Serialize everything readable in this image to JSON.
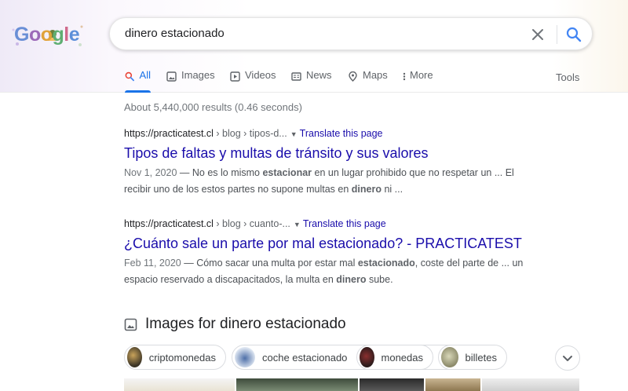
{
  "logo": {
    "text": "Google"
  },
  "search": {
    "query": "dinero estacionado"
  },
  "tabs": [
    {
      "label": "All",
      "icon": "search-icon",
      "active": true
    },
    {
      "label": "Images",
      "icon": "image-icon"
    },
    {
      "label": "Videos",
      "icon": "video-icon"
    },
    {
      "label": "News",
      "icon": "news-icon"
    },
    {
      "label": "Maps",
      "icon": "map-pin-icon"
    },
    {
      "label": "More",
      "icon": "more-vert-icon"
    }
  ],
  "tools_label": "Tools",
  "stats": "About 5,440,000 results (0.46 seconds)",
  "results": [
    {
      "domain": "https://practicatest.cl",
      "path": " › blog › tipos-d...",
      "translate": "Translate this page",
      "title": "Tipos de faltas y multas de tránsito y sus valores",
      "date": "Nov 1, 2020",
      "snippet_a": " — No es lo mismo ",
      "bold_a": "estacionar",
      "snippet_b": " en un lugar prohibido que no respetar un ... El recibir uno de los estos partes no supone multas en ",
      "bold_b": "dinero",
      "snippet_c": " ni ..."
    },
    {
      "domain": "https://practicatest.cl",
      "path": " › blog › cuanto-...",
      "translate": "Translate this page",
      "title": "¿Cuánto sale un parte por mal estacionado? - PRACTICATEST",
      "date": "Feb 11, 2020",
      "snippet_a": " — Cómo sacar una multa por estar mal ",
      "bold_a": "estacionado",
      "snippet_b": ", coste del parte de ... un espacio reservado a discapacitados, la multa en ",
      "bold_b": "dinero",
      "snippet_c": " sube."
    }
  ],
  "images_section": {
    "title": "Images for dinero estacionado",
    "chips": [
      {
        "label": "criptomonedas"
      },
      {
        "label": "coche estacionado"
      },
      {
        "label": "monedas"
      },
      {
        "label": "billetes"
      }
    ]
  },
  "colors": {
    "link": "#1a0dab",
    "accent": "#1a73e8"
  }
}
